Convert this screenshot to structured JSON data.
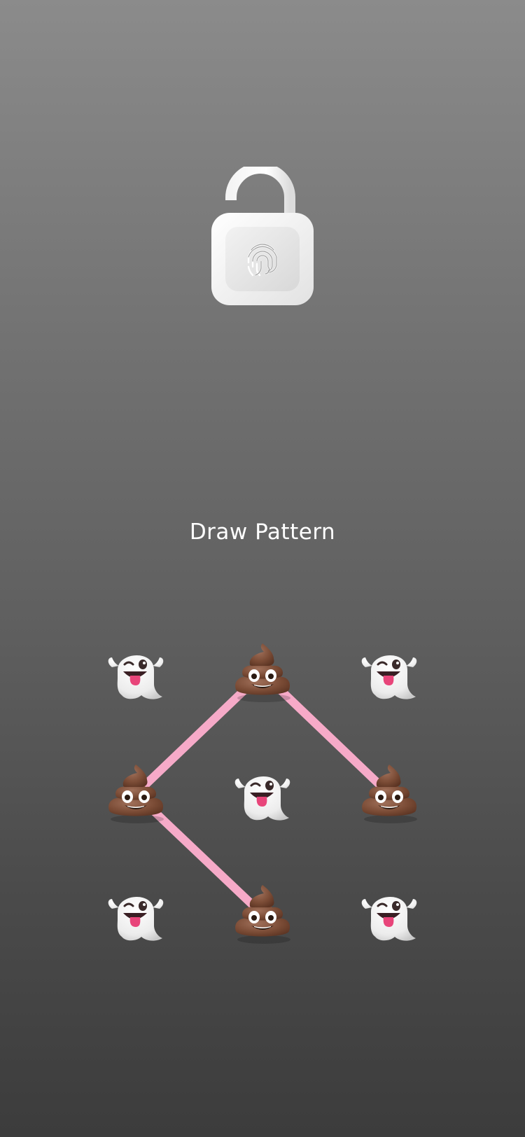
{
  "screen": {
    "title": "Draw Pattern"
  },
  "lock": {
    "icon": "unlocked-padlock-with-fingerprint"
  },
  "pattern": {
    "rows": 3,
    "cols": 3,
    "selected_path": [
      1,
      3,
      7
    ],
    "selected_path_second_branch": [
      1,
      5
    ],
    "nodes": [
      {
        "icon": "ghost-icon",
        "selected": false
      },
      {
        "icon": "poop-icon",
        "selected": true
      },
      {
        "icon": "ghost-icon",
        "selected": false
      },
      {
        "icon": "poop-icon",
        "selected": true
      },
      {
        "icon": "ghost-icon",
        "selected": false
      },
      {
        "icon": "poop-icon",
        "selected": true
      },
      {
        "icon": "ghost-icon",
        "selected": false
      },
      {
        "icon": "poop-icon",
        "selected": true
      },
      {
        "icon": "ghost-icon",
        "selected": false
      }
    ],
    "line_color": "#f6aac8"
  },
  "colors": {
    "background_top": "#8b8b8b",
    "background_bottom": "#3c3c3c",
    "text": "#ffffff"
  }
}
